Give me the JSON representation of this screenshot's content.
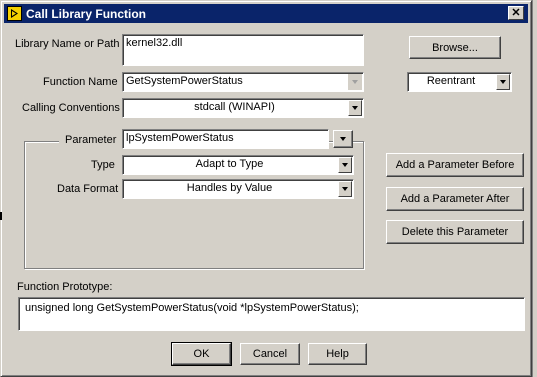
{
  "window": {
    "title": "Call Library Function",
    "close_glyph": "✕"
  },
  "library": {
    "label": "Library Name or Path",
    "value": "kernel32.dll",
    "browse_label": "Browse..."
  },
  "function_name": {
    "label": "Function Name",
    "value": "GetSystemPowerStatus"
  },
  "threading": {
    "value": "Reentrant"
  },
  "calling_conventions": {
    "label": "Calling Conventions",
    "value": "stdcall (WINAPI)"
  },
  "parameter": {
    "label": "Parameter",
    "value": "lpSystemPowerStatus",
    "type_label": "Type",
    "type_value": "Adapt to Type",
    "format_label": "Data Format",
    "format_value": "Handles by Value"
  },
  "parameter_buttons": {
    "add_before": "Add a Parameter Before",
    "add_after": "Add a Parameter After",
    "delete": "Delete this Parameter"
  },
  "prototype": {
    "label": "Function Prototype:",
    "value": "unsigned long GetSystemPowerStatus(void *lpSystemPowerStatus);"
  },
  "footer": {
    "ok": "OK",
    "cancel": "Cancel",
    "help": "Help"
  },
  "icons": [
    "app-icon",
    "close-icon",
    "dropdown-arrow-icon"
  ]
}
